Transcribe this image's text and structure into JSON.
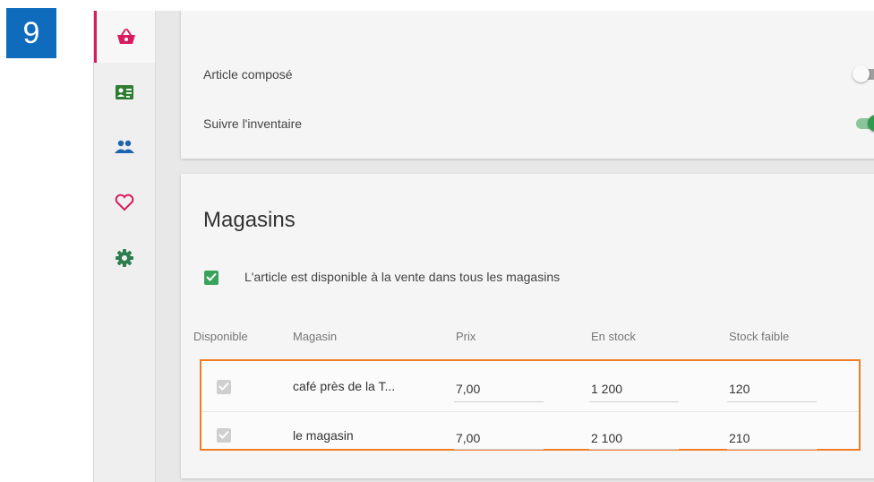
{
  "step_number": "9",
  "sidebar": {
    "items": [
      {
        "icon": "basket-icon",
        "color": "#d81b60",
        "active": true
      },
      {
        "icon": "contact-card-icon",
        "color": "#2e7d32",
        "active": false
      },
      {
        "icon": "people-icon",
        "color": "#1e63b0",
        "active": false
      },
      {
        "icon": "heart-icon",
        "color": "#d81b60",
        "active": false
      },
      {
        "icon": "gear-icon",
        "color": "#2e7d4f",
        "active": false
      }
    ]
  },
  "options": {
    "composite_label": "Article composé",
    "composite_on": false,
    "inventory_label": "Suivre l'inventaire",
    "inventory_on": true
  },
  "stores": {
    "title": "Magasins",
    "all_stores_label": "L'article est disponible à la vente dans tous les magasins",
    "all_stores_checked": true,
    "columns": [
      "Disponible",
      "Magasin",
      "Prix",
      "En stock",
      "Stock faible"
    ],
    "rows": [
      {
        "available": true,
        "store": "café près de la T...",
        "price": "7,00",
        "in_stock": "1 200",
        "low_stock": "120"
      },
      {
        "available": true,
        "store": "le magasin",
        "price": "7,00",
        "in_stock": "2 100",
        "low_stock": "210"
      }
    ]
  },
  "colors": {
    "highlight": "#f07e26",
    "accent_green": "#2e9b4e",
    "badge_blue": "#0f6cbd"
  }
}
